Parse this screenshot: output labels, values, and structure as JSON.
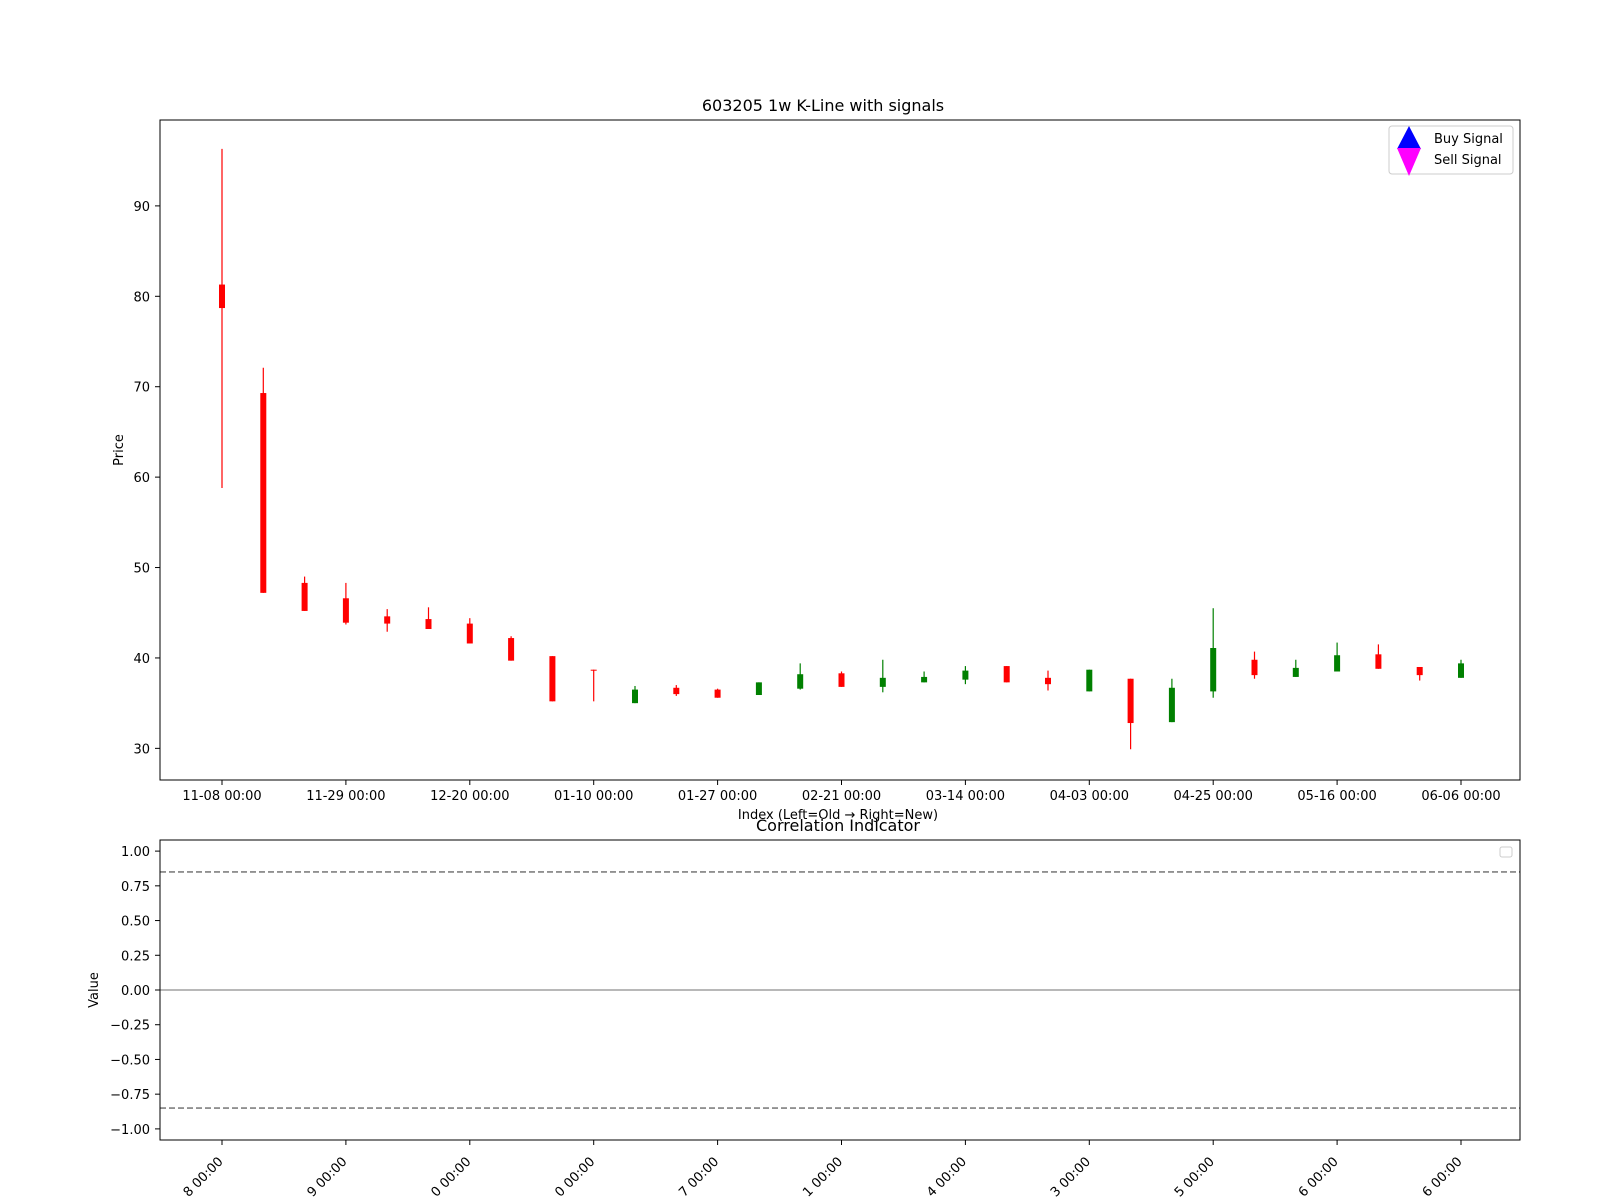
{
  "chart_data": [
    {
      "type": "candlestick",
      "title": "603205 1w K-Line with signals",
      "xlabel": "Index (Left=Old → Right=New)",
      "ylabel": "Price",
      "ylim": [
        26.5,
        99.5
      ],
      "yticks": [
        30,
        40,
        50,
        60,
        70,
        80,
        90
      ],
      "xticks": [
        {
          "index": 0,
          "label": "11-08 00:00"
        },
        {
          "index": 3,
          "label": "11-29 00:00"
        },
        {
          "index": 6,
          "label": "12-20 00:00"
        },
        {
          "index": 9,
          "label": "01-10 00:00"
        },
        {
          "index": 12,
          "label": "01-27 00:00"
        },
        {
          "index": 15,
          "label": "02-21 00:00"
        },
        {
          "index": 18,
          "label": "03-14 00:00"
        },
        {
          "index": 21,
          "label": "04-03 00:00"
        },
        {
          "index": 24,
          "label": "04-25 00:00"
        },
        {
          "index": 27,
          "label": "05-16 00:00"
        },
        {
          "index": 30,
          "label": "06-06 00:00"
        }
      ],
      "candles": [
        {
          "open": 81.3,
          "close": 78.7,
          "high": 96.3,
          "low": 58.8
        },
        {
          "open": 69.3,
          "close": 47.2,
          "high": 72.1,
          "low": 47.2
        },
        {
          "open": 48.3,
          "close": 45.2,
          "high": 49.0,
          "low": 45.2
        },
        {
          "open": 46.6,
          "close": 43.9,
          "high": 48.3,
          "low": 43.7
        },
        {
          "open": 44.6,
          "close": 43.8,
          "high": 45.4,
          "low": 42.9
        },
        {
          "open": 44.3,
          "close": 43.2,
          "high": 45.6,
          "low": 43.2
        },
        {
          "open": 43.8,
          "close": 41.6,
          "high": 44.4,
          "low": 41.6
        },
        {
          "open": 42.2,
          "close": 39.7,
          "high": 42.4,
          "low": 39.7
        },
        {
          "open": 40.2,
          "close": 35.2,
          "high": 40.2,
          "low": 35.2
        },
        {
          "open": 38.7,
          "close": 38.6,
          "high": 38.7,
          "low": 35.2
        },
        {
          "open": 35.0,
          "close": 36.5,
          "high": 36.9,
          "low": 35.0
        },
        {
          "open": 36.7,
          "close": 36.0,
          "high": 37.0,
          "low": 35.8
        },
        {
          "open": 36.5,
          "close": 35.6,
          "high": 36.6,
          "low": 35.6
        },
        {
          "open": 35.9,
          "close": 37.3,
          "high": 37.3,
          "low": 35.9
        },
        {
          "open": 36.6,
          "close": 38.2,
          "high": 39.4,
          "low": 36.5
        },
        {
          "open": 38.3,
          "close": 36.8,
          "high": 38.5,
          "low": 36.8
        },
        {
          "open": 36.8,
          "close": 37.8,
          "high": 39.8,
          "low": 36.2
        },
        {
          "open": 37.3,
          "close": 37.9,
          "high": 38.5,
          "low": 37.3
        },
        {
          "open": 37.6,
          "close": 38.6,
          "high": 39.1,
          "low": 37.1
        },
        {
          "open": 39.1,
          "close": 37.3,
          "high": 39.1,
          "low": 37.3
        },
        {
          "open": 37.8,
          "close": 37.1,
          "high": 38.6,
          "low": 36.4
        },
        {
          "open": 36.3,
          "close": 38.7,
          "high": 38.7,
          "low": 36.3
        },
        {
          "open": 37.7,
          "close": 32.8,
          "high": 37.7,
          "low": 29.9
        },
        {
          "open": 32.9,
          "close": 36.7,
          "high": 37.7,
          "low": 32.9
        },
        {
          "open": 36.3,
          "close": 41.1,
          "high": 45.5,
          "low": 35.6
        },
        {
          "open": 39.8,
          "close": 38.1,
          "high": 40.7,
          "low": 37.7
        },
        {
          "open": 37.9,
          "close": 38.9,
          "high": 39.8,
          "low": 37.9
        },
        {
          "open": 38.5,
          "close": 40.3,
          "high": 41.7,
          "low": 38.5
        },
        {
          "open": 40.4,
          "close": 38.8,
          "high": 41.5,
          "low": 38.8
        },
        {
          "open": 39.0,
          "close": 38.1,
          "high": 39.0,
          "low": 37.5
        },
        {
          "open": 37.8,
          "close": 39.4,
          "high": 39.8,
          "low": 37.8
        }
      ],
      "colors": {
        "down": "#ff0000",
        "up": "#008000"
      },
      "legend": {
        "placement": "top-right",
        "entries": [
          {
            "label": "Buy Signal",
            "color": "#0000ff",
            "marker": "triangle-up"
          },
          {
            "label": "Sell Signal",
            "color": "#ff00ff",
            "marker": "triangle-down"
          }
        ]
      }
    },
    {
      "type": "line",
      "title": "Correlation Indicator",
      "ylabel": "Value",
      "ylim": [
        -1.08,
        1.08
      ],
      "yticks": [
        1.0,
        0.75,
        0.5,
        0.25,
        0.0,
        -0.25,
        -0.5,
        -0.75,
        -1.0
      ],
      "ytick_labels": [
        "1.00",
        "0.75",
        "0.50",
        "0.25",
        "0.00",
        "−0.25",
        "−0.50",
        "−0.75",
        "−1.00"
      ],
      "xtick_labels": [
        "8 00:00",
        "9 00:00",
        "0 00:00",
        "0 00:00",
        "7 00:00",
        "1 00:00",
        "4 00:00",
        "3 00:00",
        "5 00:00",
        "6 00:00",
        "6 00:00"
      ],
      "reference_lines": [
        {
          "y": 0.85,
          "style": "dashed",
          "color": "#808080"
        },
        {
          "y": 0.0,
          "style": "solid",
          "color": "#a0a0a0"
        },
        {
          "y": -0.85,
          "style": "dashed",
          "color": "#808080"
        }
      ],
      "series": [],
      "legend": {
        "placement": "top-right",
        "entries": []
      }
    }
  ]
}
